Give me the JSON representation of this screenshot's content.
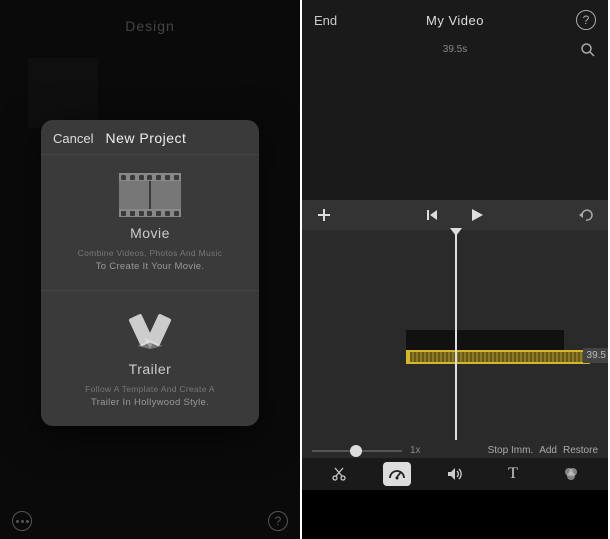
{
  "left": {
    "header": "Design",
    "modal": {
      "cancel": "Cancel",
      "title": "New Project",
      "movie": {
        "title": "Movie",
        "desc1": "Combine Videos, Photos And Music",
        "desc2": "To Create It Your Movie."
      },
      "trailer": {
        "title": "Trailer",
        "desc1": "Follow A Template And Create A",
        "desc2": "Trailer In Hollywood Style."
      }
    }
  },
  "right": {
    "end": "End",
    "title": "My Video",
    "time_top": "39.5s",
    "clip_time": "39.5",
    "speed_label": "1x",
    "actions": {
      "stop": "Stop Imm.",
      "add": "Add",
      "restore": "Restore"
    }
  }
}
